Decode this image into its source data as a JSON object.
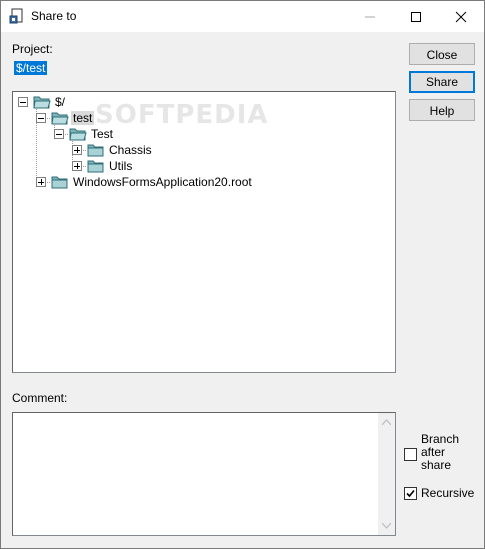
{
  "window": {
    "title": "Share to"
  },
  "project": {
    "label": "Project:",
    "value": "$/test"
  },
  "tree": {
    "nodes": [
      {
        "label": "$/",
        "expanded": true
      },
      {
        "label": "test",
        "expanded": true,
        "selected": true
      },
      {
        "label": "Test",
        "expanded": true
      },
      {
        "label": "Chassis",
        "expanded": false
      },
      {
        "label": "Utils",
        "expanded": false
      },
      {
        "label": "WindowsFormsApplication20.root",
        "expanded": false
      }
    ]
  },
  "buttons": {
    "close_label": "Close",
    "share_label": "Share",
    "help_label": "Help"
  },
  "comment": {
    "label": "Comment:",
    "value": ""
  },
  "options": {
    "branch_after_share": {
      "line1": "Branch",
      "line2": "after",
      "line3": "share",
      "checked": false
    },
    "recursive": {
      "label": "Recursive",
      "checked": true
    }
  },
  "watermark": "SOFTPEDIA",
  "colors": {
    "selection": "#0078d7",
    "tree_selection": "#d9d9d9",
    "folder": "#7fb3b8"
  }
}
